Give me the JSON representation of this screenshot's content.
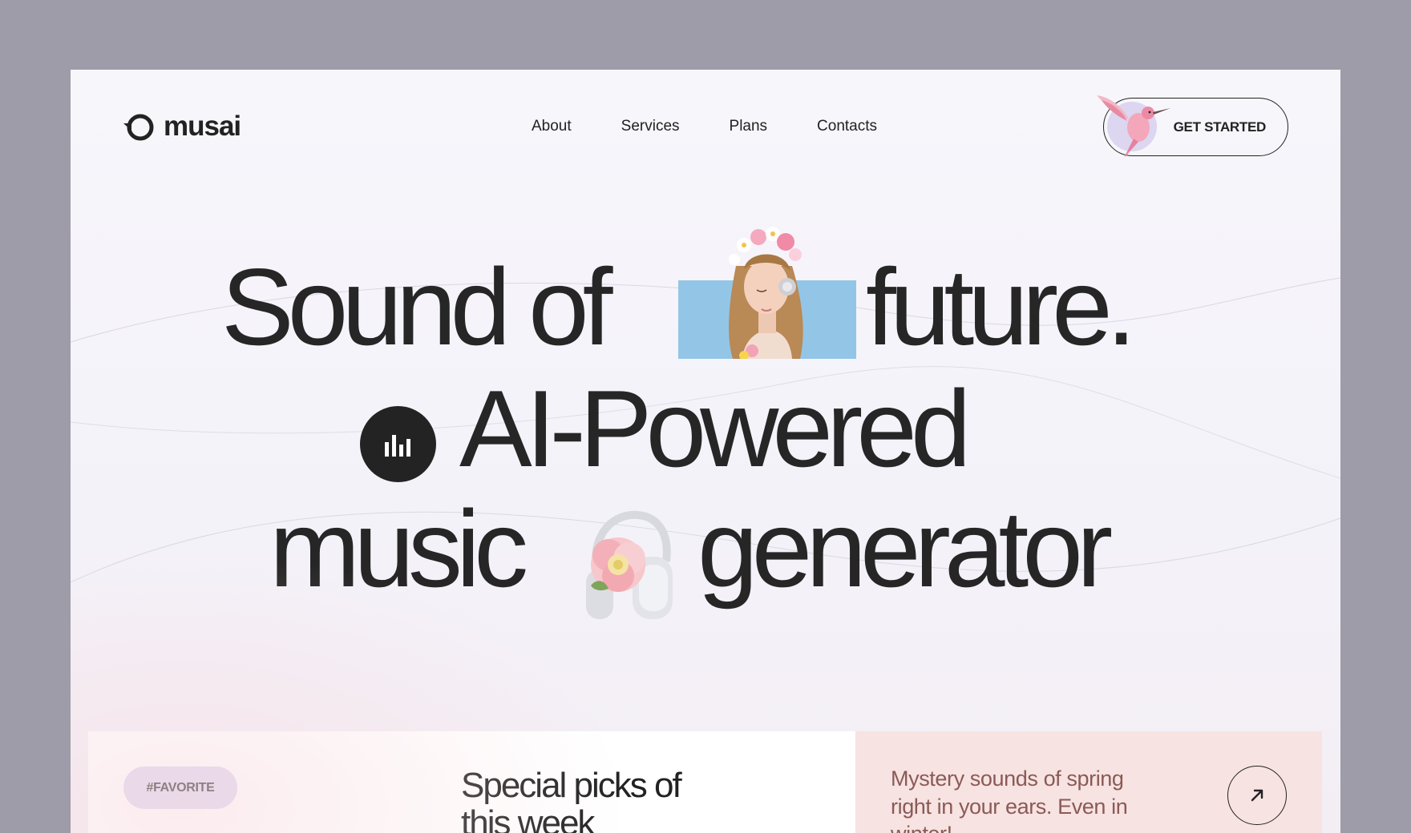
{
  "brand": {
    "name": "musai"
  },
  "nav": {
    "items": [
      {
        "label": "About"
      },
      {
        "label": "Services"
      },
      {
        "label": "Plans"
      },
      {
        "label": "Contacts"
      }
    ]
  },
  "header": {
    "cta_label": "GET STARTED"
  },
  "hero": {
    "line1_a": "Sound of",
    "line1_b": "future.",
    "line2": "AI-Powered",
    "line3_a": "music",
    "line3_b": "generator"
  },
  "cards": {
    "favorite": {
      "tag": "#FAVORITE",
      "title": "Special picks of this week"
    },
    "promo": {
      "text": "Mystery sounds of spring right in your ears. Even in winter!"
    }
  },
  "colors": {
    "frame_background": "#f7f6fb",
    "outer_background": "#9d9ca8",
    "lavender_accent": "#dcd6f0",
    "sky_blue": "#93c6e6",
    "blush_card": "#f7e3e1",
    "promo_text": "#8a5a57",
    "ink": "#222222"
  },
  "icons": {
    "logo": "ring-logo-icon",
    "hero_badge": "equalizer-icon",
    "promo_button": "arrow-up-right-icon"
  }
}
